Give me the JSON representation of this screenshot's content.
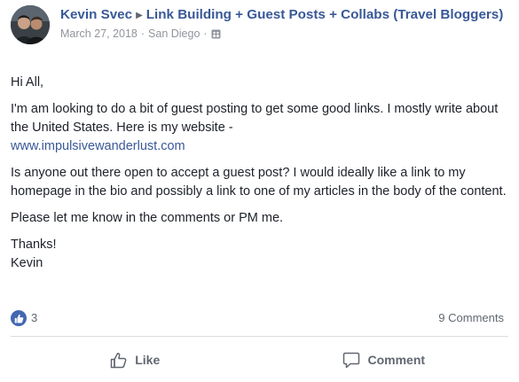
{
  "post": {
    "author": "Kevin Svec",
    "group": "Link Building + Guest Posts + Collabs (Travel Bloggers)",
    "date": "March 27, 2018",
    "location": "San Diego",
    "privacy_icon": "public-group-icon",
    "body": {
      "greeting": "Hi All,",
      "p1": "I'm am looking to do a bit of guest posting to get some good links. I mostly write about the United States. Here is my website -",
      "link": "www.impulsivewanderlust.com",
      "p2": "Is anyone out there open to accept a guest post? I would ideally like a link to my homepage in the bio and possibly a link to one of my articles in the body of the content.",
      "p3": "Please let me know in the comments or PM me.",
      "signoff": "Thanks!",
      "signature": "Kevin"
    }
  },
  "stats": {
    "like_count": "3",
    "comments_label": "9 Comments"
  },
  "actions": {
    "like_label": "Like",
    "comment_label": "Comment"
  },
  "colors": {
    "link_blue": "#385898",
    "meta_gray": "#90949c",
    "action_gray": "#606770",
    "like_badge": "#4267b2"
  }
}
